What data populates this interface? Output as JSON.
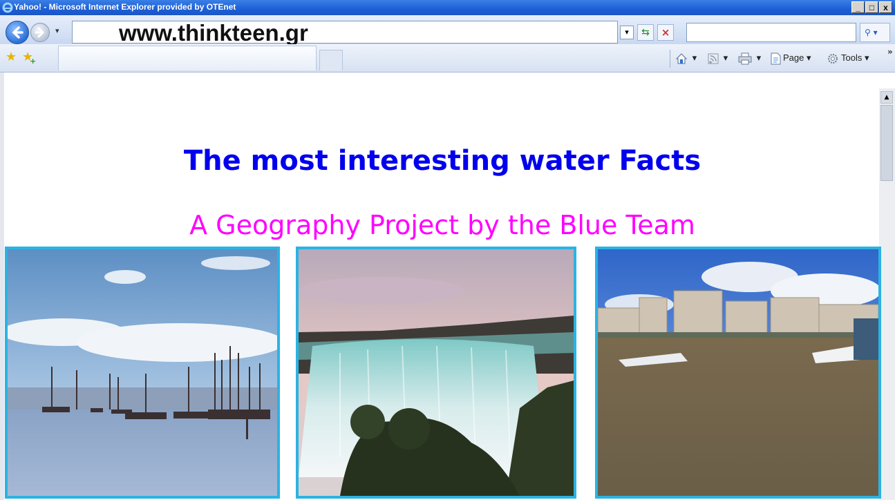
{
  "window": {
    "title": "Yahoo! - Microsoft Internet Explorer provided by OTEnet",
    "minimize_label": "_",
    "maximize_label": "□",
    "close_label": "x"
  },
  "address_bar": {
    "url": "www.thinkteen.gr"
  },
  "command_bar": {
    "items": [
      {
        "label": "",
        "icon": "home-icon"
      },
      {
        "label": "",
        "icon": "feeds-icon"
      },
      {
        "label": "",
        "icon": "print-icon"
      },
      {
        "label": "Page",
        "icon": "page-icon"
      },
      {
        "label": "Tools",
        "icon": "tools-icon"
      }
    ]
  },
  "page": {
    "headline": "The most interesting water Facts",
    "subtitle": "A Geography Project by the Blue Team",
    "images": [
      {
        "subject": "sailboats on a lake"
      },
      {
        "subject": "waterfall"
      },
      {
        "subject": "river with city buildings"
      }
    ]
  },
  "colors": {
    "headline": "#0000ee",
    "subtitle": "#ff00ff",
    "photo_border": "#2bb3e3",
    "titlebar": "#1d5fd6"
  }
}
